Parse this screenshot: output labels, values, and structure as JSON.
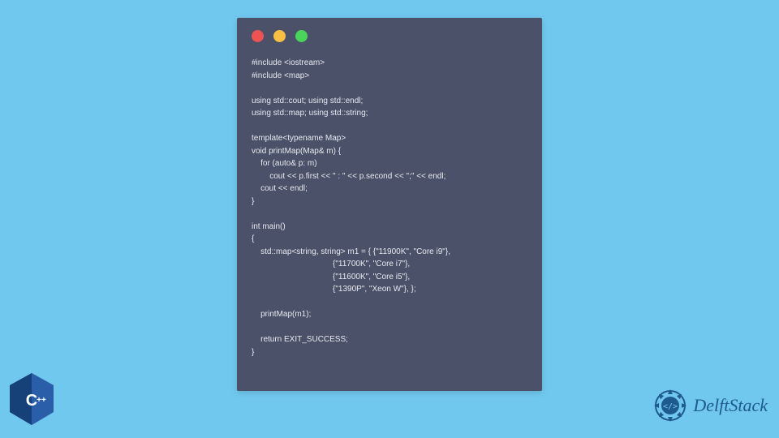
{
  "code": {
    "lines": [
      "#include <iostream>",
      "#include <map>",
      "",
      "using std::cout; using std::endl;",
      "using std::map; using std::string;",
      "",
      "template<typename Map>",
      "void printMap(Map& m) {",
      "    for (auto& p: m)",
      "        cout << p.first << \" : \" << p.second << \";\" << endl;",
      "    cout << endl;",
      "}",
      "",
      "int main()",
      "{",
      "    std::map<string, string> m1 = { {\"11900K\", \"Core i9\"},",
      "                                    {\"11700K\", \"Core i7\"},",
      "                                    {\"11600K\", \"Core i5\"},",
      "                                    {\"1390P\", \"Xeon W\"}, };",
      "",
      "    printMap(m1);",
      "",
      "    return EXIT_SUCCESS;",
      "}"
    ]
  },
  "logos": {
    "cpp_label": "C++",
    "delft_label": "DelftStack"
  },
  "colors": {
    "background": "#71c8ef",
    "window": "#4a5169",
    "text": "#e8e9ee",
    "dot_red": "#ed5353",
    "dot_yellow": "#f7c044",
    "dot_green": "#4bd45b",
    "cpp_blue": "#1e4a8c",
    "delft_blue": "#1f5a8f"
  }
}
